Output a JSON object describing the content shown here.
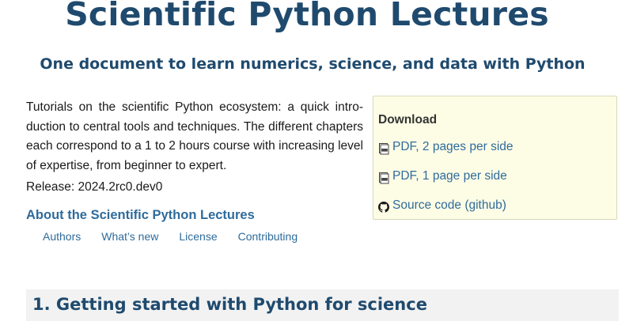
{
  "header": {
    "title": "Scientific Python Lectures",
    "subtitle": "One document to learn numerics, science, and data with Python"
  },
  "intro": {
    "text": "Tutorials on the scientific Python ecosystem: a quick intro­duction to central tools and techniques. The different chap­ters each correspond to a 1 to 2 hours course with increas­ing level of expertise, from beginner to expert.",
    "release": "Release: 2024.2rc0.dev0"
  },
  "about": {
    "heading": "About the Scientific Python Lectures",
    "links": [
      "Authors",
      "What’s new",
      "License",
      "Contributing"
    ]
  },
  "download": {
    "title": "Download",
    "items": [
      {
        "label": "PDF, 2 pages per side",
        "icon": "pdf-icon"
      },
      {
        "label": "PDF, 1 page per side",
        "icon": "pdf-icon"
      },
      {
        "label": "Source code (github)",
        "icon": "github-icon"
      }
    ]
  },
  "section": {
    "heading": "1. Getting started with Python for science"
  },
  "colors": {
    "title": "#1f4a6e",
    "link": "#2f6b9b",
    "download_bg": "#fdfde6",
    "section_bg": "#f2f2f2"
  }
}
